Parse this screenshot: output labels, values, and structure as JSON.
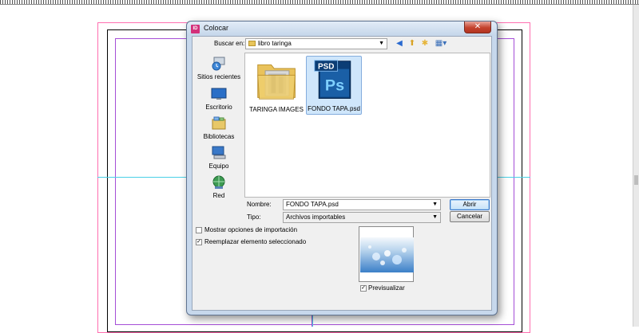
{
  "dialog": {
    "title": "Colocar",
    "app_icon": "ID"
  },
  "toolbar": {
    "look_in_label": "Buscar en:",
    "look_in_value": "libro taringa",
    "icons": [
      "back-icon",
      "up-folder-icon",
      "new-folder-icon",
      "view-menu-icon"
    ]
  },
  "places": [
    {
      "label": "Sitios recientes",
      "icon": "recent-places-icon"
    },
    {
      "label": "Escritorio",
      "icon": "desktop-icon"
    },
    {
      "label": "Bibliotecas",
      "icon": "libraries-icon"
    },
    {
      "label": "Equipo",
      "icon": "computer-icon"
    },
    {
      "label": "Red",
      "icon": "network-icon"
    }
  ],
  "files": [
    {
      "name": "TARINGA IMAGES",
      "type": "folder",
      "selected": false
    },
    {
      "name": "FONDO TAPA.psd",
      "type": "psd",
      "badge": "PSD",
      "logo": "Ps",
      "selected": true
    }
  ],
  "filename": {
    "label": "Nombre:",
    "value": "FONDO TAPA.psd"
  },
  "filetype": {
    "label": "Tipo:",
    "value": "Archivos importables"
  },
  "buttons": {
    "open": "Abrir",
    "cancel": "Cancelar"
  },
  "options": {
    "show_import": {
      "label": "Mostrar opciones de importación",
      "checked": false
    },
    "replace_selected": {
      "label": "Reemplazar elemento seleccionado",
      "checked": true
    }
  },
  "preview": {
    "label": "Previsualizar",
    "checked": true
  },
  "colors": {
    "psd_blue": "#0b3d75",
    "psd_accent": "#2da0e6",
    "selection": "#cfe6fb",
    "bleed": "#ff6fb0",
    "margin": "#a54ed6",
    "guide": "#49d0e6"
  }
}
